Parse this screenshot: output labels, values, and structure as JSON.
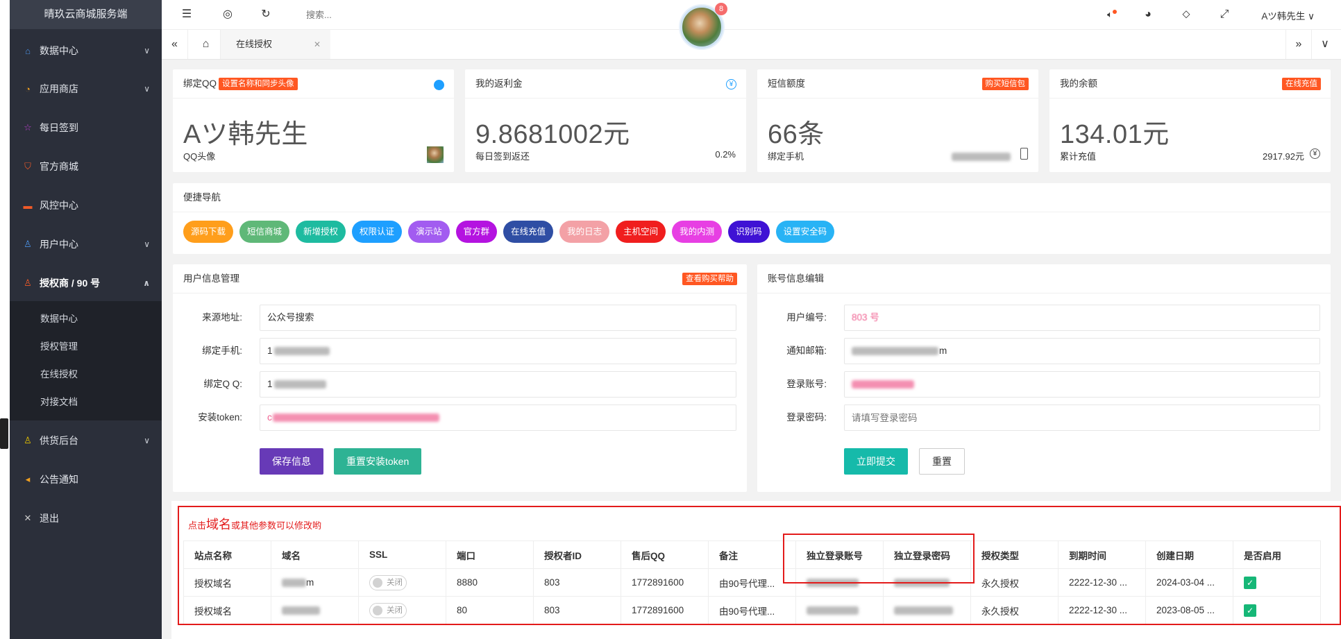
{
  "app": {
    "title": "晴玖云商城服务端"
  },
  "sidebar": {
    "items": [
      {
        "label": "数据中心",
        "icon": "home-icon"
      },
      {
        "label": "应用商店",
        "icon": "shop-icon"
      },
      {
        "label": "每日签到",
        "icon": "star-icon"
      },
      {
        "label": "官方商城",
        "icon": "cart-icon"
      },
      {
        "label": "风控中心",
        "icon": "shield-icon"
      },
      {
        "label": "用户中心",
        "icon": "user-icon"
      },
      {
        "label": "授权商 / 90 号",
        "icon": "user-icon"
      },
      {
        "label": "供货后台",
        "icon": "user-icon"
      },
      {
        "label": "公告通知",
        "icon": "speaker-icon"
      },
      {
        "label": "退出",
        "icon": "close-icon"
      }
    ],
    "submenu": [
      "数据中心",
      "授权管理",
      "在线授权",
      "对接文档"
    ]
  },
  "topbar": {
    "search_placeholder": "搜索...",
    "badge": "8",
    "user": "Aツ韩先生"
  },
  "tabs": {
    "active": "在线授权"
  },
  "stats": [
    {
      "title": "绑定QQ",
      "tag": "设置名称和同步头像",
      "value": "Aツ韩先生",
      "foot_left": "QQ头像",
      "foot_right": ""
    },
    {
      "title": "我的返利金",
      "tag": "",
      "value": "9.8681002元",
      "foot_left": "每日签到返还",
      "foot_right": "0.2%"
    },
    {
      "title": "短信额度",
      "tag": "购买短信包",
      "value": "66条",
      "foot_left": "绑定手机",
      "foot_right": ""
    },
    {
      "title": "我的余额",
      "tag": "在线充值",
      "value": "134.01元",
      "foot_left": "累计充值",
      "foot_right": "2917.92元"
    }
  ],
  "quicknav": {
    "title": "便捷导航",
    "buttons": [
      {
        "label": "源码下载",
        "color": "#ff9e1b"
      },
      {
        "label": "短信商城",
        "color": "#5fb878"
      },
      {
        "label": "新增授权",
        "color": "#1ebba0"
      },
      {
        "label": "权限认证",
        "color": "#1e9fff"
      },
      {
        "label": "演示站",
        "color": "#a25cf0"
      },
      {
        "label": "官方群",
        "color": "#b413e0"
      },
      {
        "label": "在线充值",
        "color": "#2f4ea4"
      },
      {
        "label": "我的日志",
        "color": "#f3a1a6"
      },
      {
        "label": "主机空间",
        "color": "#f01e1e"
      },
      {
        "label": "我的内测",
        "color": "#e73fe3"
      },
      {
        "label": "识别码",
        "color": "#3f12d4"
      },
      {
        "label": "设置安全码",
        "color": "#28b3f5"
      }
    ]
  },
  "userinfo": {
    "title": "用户信息管理",
    "tag": "查看购买帮助",
    "fields": [
      {
        "label": "来源地址:",
        "value": "公众号搜索"
      },
      {
        "label": "绑定手机:",
        "value": "1"
      },
      {
        "label": "绑定Q Q:",
        "value": "1"
      },
      {
        "label": "安装token:",
        "value": "c"
      }
    ],
    "save": "保存信息",
    "reset_token": "重置安装token"
  },
  "account": {
    "title": "账号信息编辑",
    "fields": [
      {
        "label": "用户编号:",
        "value": "803 号"
      },
      {
        "label": "通知邮箱:",
        "value": "m"
      },
      {
        "label": "登录账号:",
        "value": ""
      },
      {
        "label": "登录密码:",
        "placeholder": "请填写登录密码"
      }
    ],
    "submit": "立即提交",
    "reset": "重置"
  },
  "table": {
    "tip_prefix": "点击",
    "tip_big": "域名",
    "tip_suffix": "或其他参数可以修改哟",
    "headers": [
      "站点名称",
      "域名",
      "SSL",
      "端口",
      "授权者ID",
      "售后QQ",
      "备注",
      "独立登录账号",
      "独立登录密码",
      "授权类型",
      "到期时间",
      "创建日期",
      "是否启用"
    ],
    "rows": [
      {
        "site": "授权域名",
        "domain": "m",
        "ssl": "关闭",
        "port": "8880",
        "uid": "803",
        "qq": "1772891600",
        "note": "由90号代理...",
        "type": "永久授权",
        "expire": "2222-12-30 ...",
        "created": "2024-03-04 ..."
      },
      {
        "site": "授权域名",
        "domain": "",
        "ssl": "关闭",
        "port": "80",
        "uid": "803",
        "qq": "1772891600",
        "note": "由90号代理...",
        "type": "永久授权",
        "expire": "2222-12-30 ...",
        "created": "2023-08-05 ..."
      }
    ]
  },
  "colors": {
    "accent_red": "#ff5722",
    "sidebar_bg": "#2b2f3a",
    "save_btn": "#673ab7",
    "teal_btn": "#2eb394",
    "submit_btn": "#16baaa"
  }
}
